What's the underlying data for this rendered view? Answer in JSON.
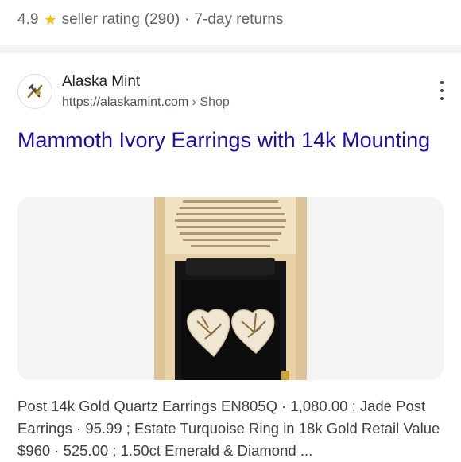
{
  "rating": {
    "score": "4.9",
    "star_icon": "star-icon",
    "label": "seller rating",
    "count_open": "(",
    "count": "290",
    "count_close": ")",
    "separator": "·",
    "returns": "7-day returns"
  },
  "result": {
    "site_name": "Alaska Mint",
    "url": "https://alaskamint.com",
    "breadcrumb_sep": "›",
    "breadcrumb": "Shop",
    "title": "Mammoth Ivory Earrings with 14k Mounting",
    "snippet": "Post 14k Gold Quartz Earrings EN805Q · 1,080.00 ; Jade Post Earrings · 95.99 ; Estate Turquoise Ring in 18k Gold Retail Value $960 · 525.00 ; 1.50ct Emerald & Diamond ..."
  },
  "colors": {
    "link": "#1a0dab",
    "star": "#fbbc04",
    "text_secondary": "#5f6368"
  },
  "icons": [
    "star-icon",
    "site-favicon-icon",
    "more-vert-icon"
  ]
}
